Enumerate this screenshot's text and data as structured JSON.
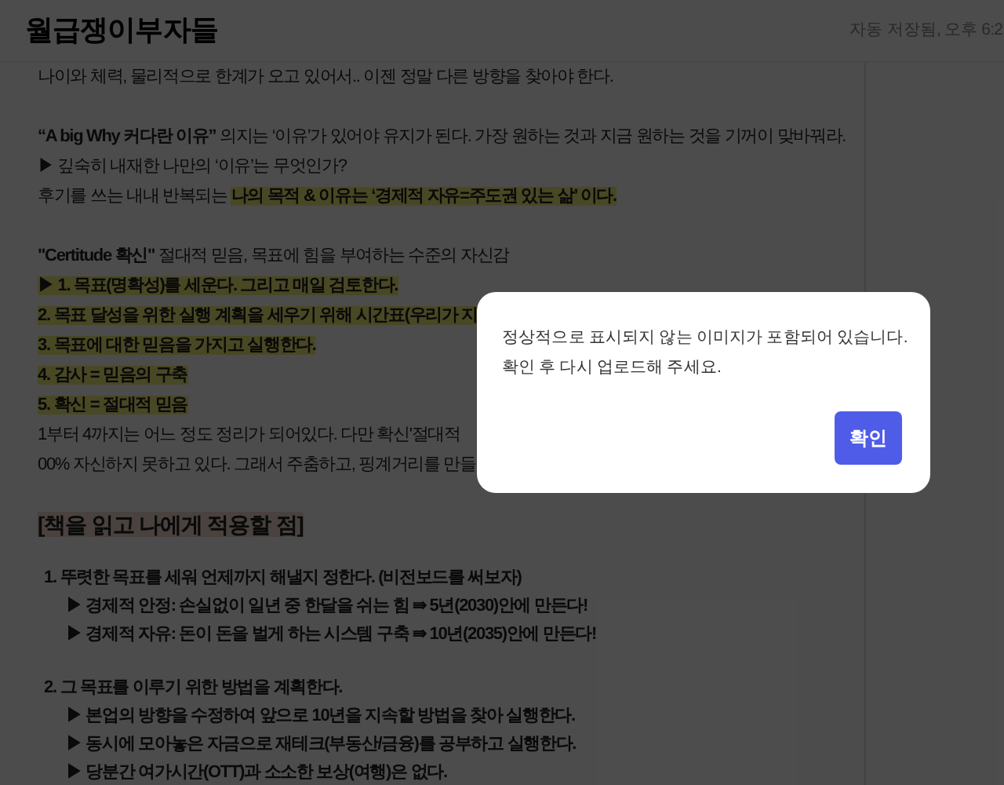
{
  "header": {
    "title": "월급쟁이부자들",
    "save_status": "자동 저장됨, 오후 6:2"
  },
  "lines": [
    {
      "kind": "text",
      "segments": [
        {
          "text": "나이와 체력, 물리적으로 한계가 오고 있어서.. 이젠 정말 다른 방향을 찾아야 한다.",
          "highlighted": false
        }
      ]
    },
    {
      "kind": "blank"
    },
    {
      "kind": "text",
      "segments": [
        {
          "text": "**“A big Why 커다란 이유”** 의지는 ‘이유’가 있어야 유지가 된다. 가장 원하는 것과 지금 원하는 것을 기꺼이 맞바꿔라.",
          "highlighted": false
        }
      ]
    },
    {
      "kind": "text",
      "segments": [
        {
          "text": "▶ 깊숙히 내재한 나만의 ‘이유’는 무엇인가?",
          "highlighted": false
        }
      ]
    },
    {
      "kind": "text",
      "segments": [
        {
          "text": "후기를 쓰는 내내 반복되는 ",
          "highlighted": false
        },
        {
          "text": "**나의 목적 & 이유는 ‘경제적 자유=주도권 있는 삶’ 이다.**",
          "highlighted": true
        }
      ]
    },
    {
      "kind": "blank"
    },
    {
      "kind": "text",
      "segments": [
        {
          "text": "**\"Certitude 확신\"** 절대적 믿음, 목표에 힘을 부여하는 수준의 자신감",
          "highlighted": false
        }
      ]
    },
    {
      "kind": "text",
      "segments": [
        {
          "text": "**▶ 1. 목표(명확성)를 세운다. 그리고 매일 검토한다.**",
          "highlighted": true
        }
      ]
    },
    {
      "kind": "text",
      "segments": [
        {
          "text": "**2. 목표 달성을 위한 실행 계획을 세우기 위해 시간표(우리가 지**",
          "highlighted": true
        }
      ]
    },
    {
      "kind": "text",
      "segments": [
        {
          "text": "**3. 목표에 대한 믿음을 가지고 실행한다.**",
          "highlighted": true
        }
      ]
    },
    {
      "kind": "text",
      "segments": [
        {
          "text": "**4. 감사 = 믿음의 구축**",
          "highlighted": true
        }
      ]
    },
    {
      "kind": "text",
      "segments": [
        {
          "text": "**5. 확신 = 절대적 믿음**",
          "highlighted": true
        }
      ]
    },
    {
      "kind": "text",
      "segments": [
        {
          "text": "1부터 4까지는 어느 정도 정리가 되어있다. 다만 확신'절대적",
          "highlighted": false
        }
      ]
    },
    {
      "kind": "text",
      "segments": [
        {
          "text": "00% 자신하지 못하고 있다. 그래서 주춤하고, 핑계거리를 만들",
          "highlighted": false
        }
      ]
    },
    {
      "kind": "blank"
    },
    {
      "kind": "heading",
      "segments": [
        {
          "text": "[책을 읽고 나에게 적용할 점]",
          "highlighted": true
        }
      ]
    },
    {
      "kind": "blank"
    },
    {
      "kind": "list_item",
      "segments": [
        {
          "text": "**1. 뚜렷한 목표를 세워 언제까지 해낼지 정한다. (비전보드를 써보자)**",
          "highlighted": false
        }
      ]
    },
    {
      "kind": "sub_item",
      "segments": [
        {
          "text": "**▶ 경제적 안정: 손실없이 일년 중 한달을 쉬는 힘 ⇛ 5년(2030)안에 만든다!**",
          "highlighted": false
        }
      ]
    },
    {
      "kind": "sub_item",
      "segments": [
        {
          "text": "**▶ 경제적 자유: 돈이 돈을 벌게 하는 시스템 구축 ⇛ 10년(2035)안에 만든다!**",
          "highlighted": false
        }
      ]
    },
    {
      "kind": "blank"
    },
    {
      "kind": "list_item",
      "segments": [
        {
          "text": "**2. 그 목표를 이루기 위한 방법을 계획한다.**",
          "highlighted": false
        }
      ]
    },
    {
      "kind": "sub_item",
      "segments": [
        {
          "text": "**▶ 본업의 방향을 수정하여 앞으로 10년을 지속할 방법을 찾아 실행한다.**",
          "highlighted": false
        }
      ]
    },
    {
      "kind": "sub_item",
      "segments": [
        {
          "text": "**▶ 동시에 모아놓은 자금으로 재테크(부동산/금융)를 공부하고 실행한다.**",
          "highlighted": false
        }
      ]
    },
    {
      "kind": "sub_item",
      "segments": [
        {
          "text": "**▶ 당분간 여가시간(OTT)과 소소한 보상(여행)은 없다.**",
          "highlighted": false
        }
      ]
    }
  ],
  "dialog": {
    "message": [
      "정상적으로 표시되지 않는 이미지가 포함되어 있습니다.",
      "확인 후 다시 업로드해 주세요."
    ],
    "button": "확인"
  }
}
